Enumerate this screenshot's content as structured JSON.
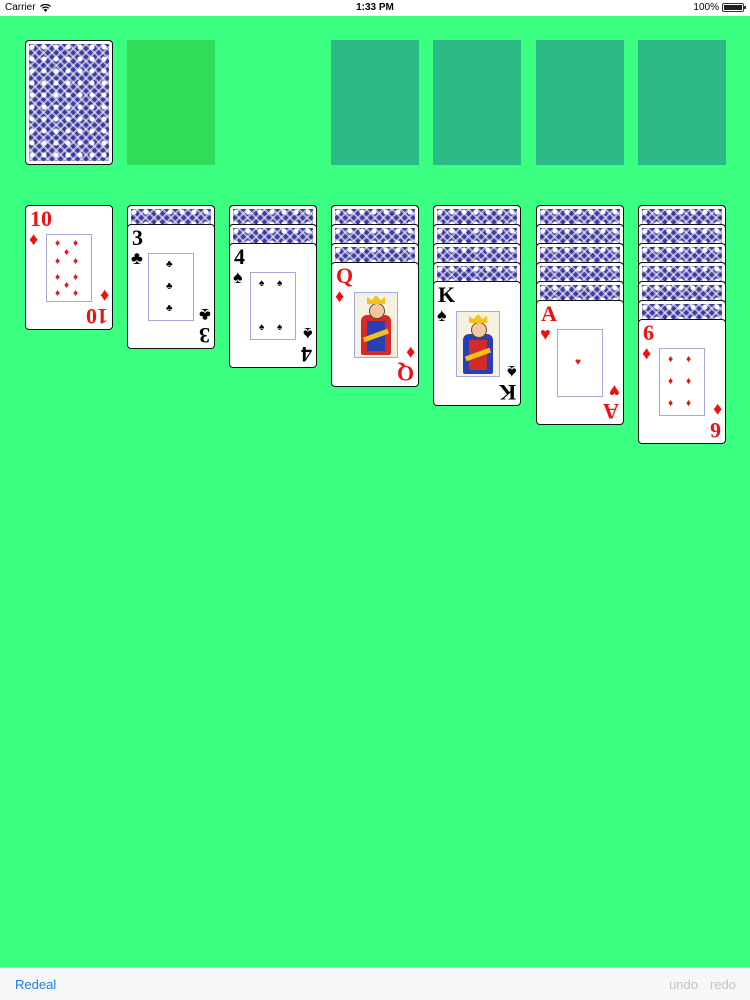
{
  "status_bar": {
    "carrier": "Carrier",
    "time": "1:33 PM",
    "battery": "100%"
  },
  "toolbar": {
    "redeal_label": "Redeal",
    "undo_label": "undo",
    "redo_label": "redo"
  },
  "colors": {
    "table": "#3bff80",
    "waste_slot": "#30dc58",
    "foundation_slot": "#2bb985",
    "accent": "#1d7bf0",
    "red_suit": "#ee1111",
    "black_suit": "#000000"
  },
  "tableau": [
    {
      "face_down": 0,
      "rank": "10",
      "suit": "♦",
      "color": "red"
    },
    {
      "face_down": 1,
      "rank": "3",
      "suit": "♣",
      "color": "black"
    },
    {
      "face_down": 2,
      "rank": "4",
      "suit": "♠",
      "color": "black"
    },
    {
      "face_down": 3,
      "rank": "Q",
      "suit": "♦",
      "color": "red"
    },
    {
      "face_down": 4,
      "rank": "K",
      "suit": "♠",
      "color": "black"
    },
    {
      "face_down": 5,
      "rank": "A",
      "suit": "♥",
      "color": "red"
    },
    {
      "face_down": 6,
      "rank": "6",
      "suit": "♦",
      "color": "red"
    }
  ]
}
